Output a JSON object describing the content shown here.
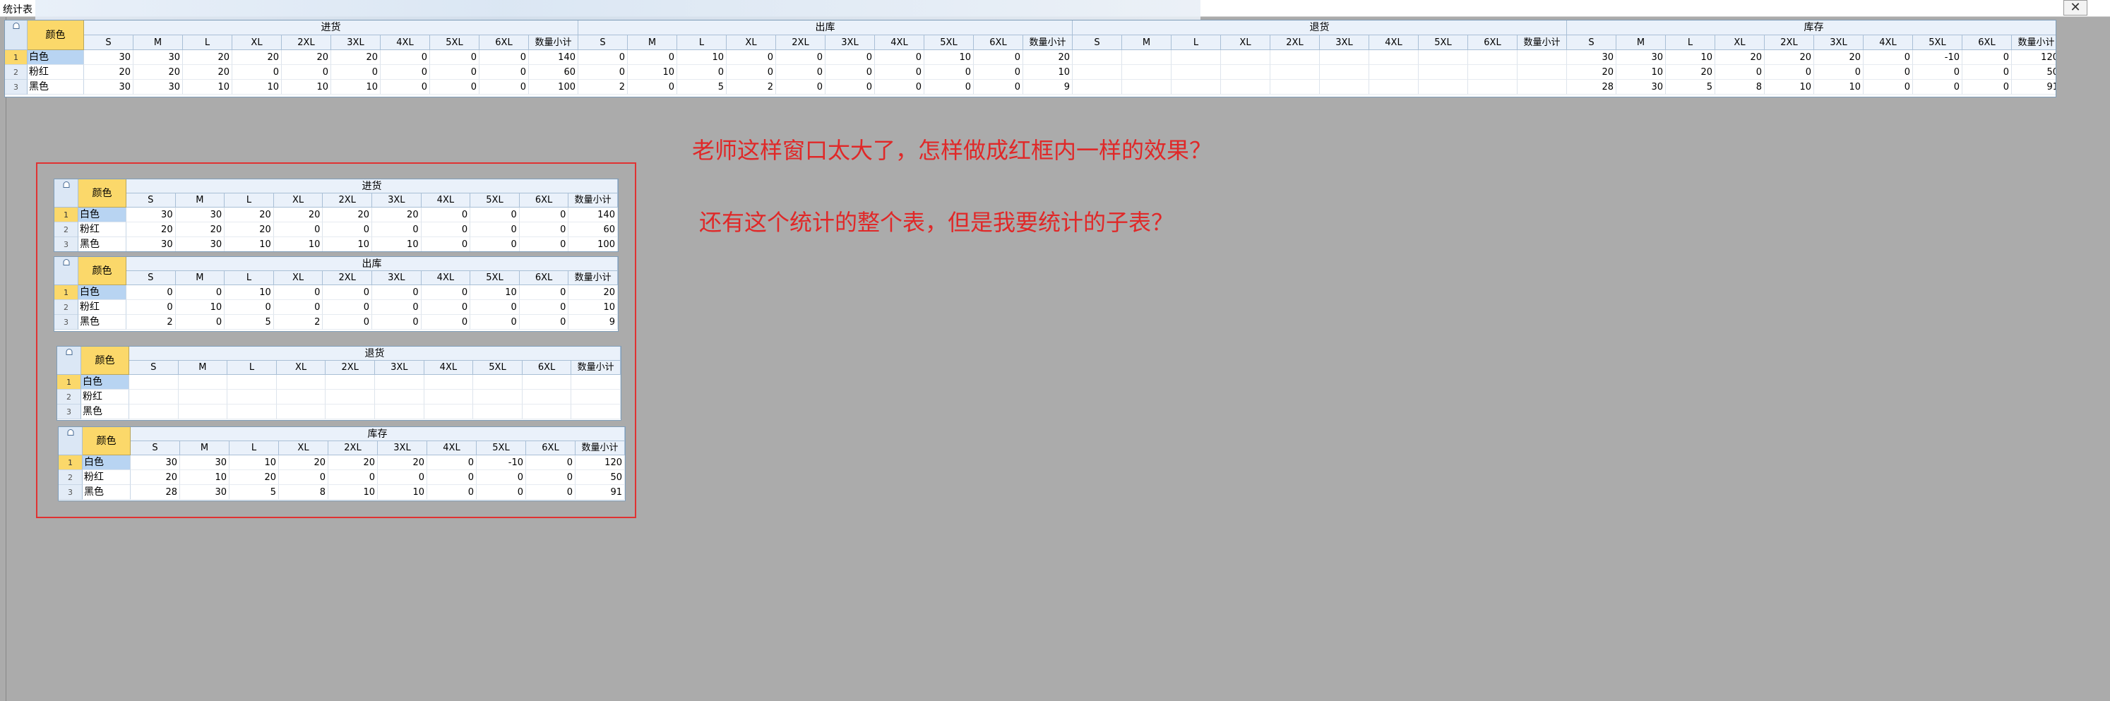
{
  "window": {
    "title": "统计表",
    "close_icon": "close-icon"
  },
  "color_header": "颜色",
  "size_columns": [
    "S",
    "M",
    "L",
    "XL",
    "2XL",
    "3XL",
    "4XL",
    "5XL",
    "6XL",
    "数量小计"
  ],
  "rows": [
    "白色",
    "粉红",
    "黑色"
  ],
  "row_numbers": [
    "1",
    "2",
    "3"
  ],
  "groups": [
    {
      "title": "进货",
      "values": [
        [
          "30",
          "30",
          "20",
          "20",
          "20",
          "20",
          "0",
          "0",
          "0",
          "140"
        ],
        [
          "20",
          "20",
          "20",
          "0",
          "0",
          "0",
          "0",
          "0",
          "0",
          "60"
        ],
        [
          "30",
          "30",
          "10",
          "10",
          "10",
          "10",
          "0",
          "0",
          "0",
          "100"
        ]
      ]
    },
    {
      "title": "出库",
      "values": [
        [
          "0",
          "0",
          "10",
          "0",
          "0",
          "0",
          "0",
          "10",
          "0",
          "20"
        ],
        [
          "0",
          "10",
          "0",
          "0",
          "0",
          "0",
          "0",
          "0",
          "0",
          "10"
        ],
        [
          "2",
          "0",
          "5",
          "2",
          "0",
          "0",
          "0",
          "0",
          "0",
          "9"
        ]
      ]
    },
    {
      "title": "退货",
      "values": [
        [
          "",
          "",
          "",
          "",
          "",
          "",
          "",
          "",
          "",
          ""
        ],
        [
          "",
          "",
          "",
          "",
          "",
          "",
          "",
          "",
          "",
          ""
        ],
        [
          "",
          "",
          "",
          "",
          "",
          "",
          "",
          "",
          "",
          ""
        ]
      ]
    },
    {
      "title": "库存",
      "values": [
        [
          "30",
          "30",
          "10",
          "20",
          "20",
          "20",
          "0",
          "-10",
          "0",
          "120"
        ],
        [
          "20",
          "10",
          "20",
          "0",
          "0",
          "0",
          "0",
          "0",
          "0",
          "50"
        ],
        [
          "28",
          "30",
          "5",
          "8",
          "10",
          "10",
          "0",
          "0",
          "0",
          "91"
        ]
      ]
    }
  ],
  "annotations": {
    "line1": "老师这样窗口太大了，怎样做成红框内一样的效果？",
    "line2": "还有这个统计的整个表，但是我要统计的子表？"
  },
  "colors": {
    "background": "#ababab",
    "header_blue": "#eaf1fa",
    "color_header_yellow": "#fbd86a",
    "selected_cell": "#b8d4f2",
    "annotation_red": "#e02828"
  }
}
